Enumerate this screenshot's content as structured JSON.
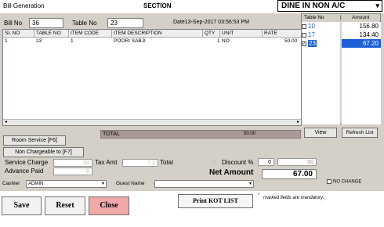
{
  "window": {
    "title": "Bill Generation",
    "section": "SECTION",
    "mode": "DINE IN NON A/C"
  },
  "bill": {
    "bill_no_label": "Bill No",
    "bill_no": "36",
    "table_no_label": "Table No",
    "table_no": "23",
    "date_text": "Date13-Sep-2017 03:56:53 PM"
  },
  "grid": {
    "headers": [
      "SL NO",
      "TABLE NO",
      "ITEM CODE",
      "ITEM DESCRIPTION",
      "QTY",
      "UNIT",
      "RATE"
    ],
    "rows": [
      [
        "1",
        "23",
        "1",
        "POORI SABJI",
        "1",
        "NO",
        "50.00"
      ]
    ]
  },
  "side": {
    "col_table": "Table No",
    "col_amount": "Amount",
    "rows": [
      {
        "table": "10",
        "amount": "156.80",
        "checked": false,
        "selected": false
      },
      {
        "table": "17",
        "amount": "134.40",
        "checked": false,
        "selected": false
      },
      {
        "table": "23",
        "amount": "67.20",
        "checked": true,
        "selected": true
      }
    ]
  },
  "total": {
    "label": "TOTAL",
    "value": "50.00"
  },
  "buttons": {
    "view": "View",
    "refresh": "Refresh List",
    "room_service": "Room Service [F6]",
    "non_chargeable": "Non Chargeable to [F7]",
    "save": "Save",
    "reset": "Reset",
    "close": "Close",
    "print_kot": "Print KOT LIST"
  },
  "charges": {
    "service_charge_label": "Service Charge",
    "service_charge": ".00",
    "advance_paid_label": "Advance Paid",
    "advance_paid": "0",
    "tax_amt_label": "Tax Amt",
    "tax_amt": "7.2",
    "total_label": "Total",
    "total": "0",
    "discount_label": "Discount %",
    "discount_pct": "0",
    "discount_amt": ".00",
    "net_amount_label": "Net Amount",
    "net_amount": "67.00"
  },
  "fields": {
    "cashier_label": "Cashier",
    "cashier": "ADMIN",
    "guest_label": "Guest Name",
    "guest": "",
    "no_change_label": "NO CHANGE"
  },
  "footer": {
    "mandatory_star": "*",
    "mandatory_note": "marked fields are mandatory.."
  },
  "colors": {
    "panel": "#d4d0c8",
    "total_bar": "#a89a94",
    "close_button": "#f0a8a8",
    "selected_row": "#1c5fd6"
  }
}
